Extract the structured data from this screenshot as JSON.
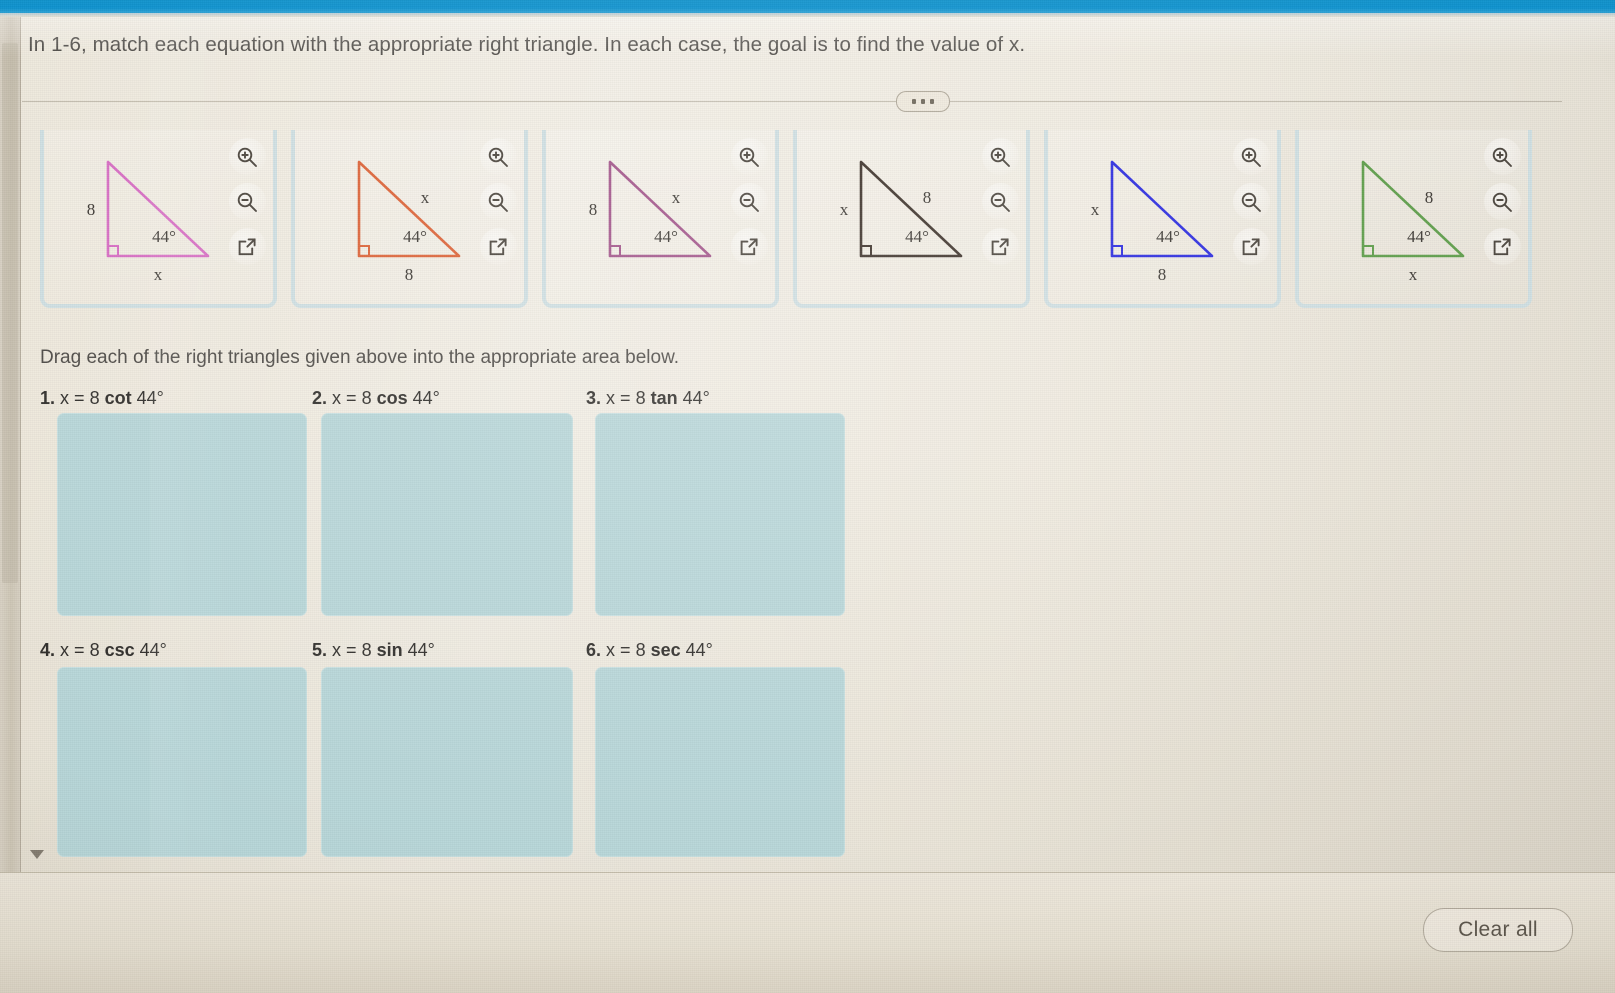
{
  "topbar": {
    "color": "#0f93cf"
  },
  "prompt": {
    "text": "In 1-6, match each equation with the appropriate right triangle. In each case, the goal is to find the value of x."
  },
  "divider": {
    "expander_label": "•••"
  },
  "cards": {
    "icons": {
      "zoom_in": "zoom-in-icon",
      "zoom_out": "zoom-out-icon",
      "open_new": "open-in-new-window-icon"
    },
    "items": [
      {
        "id": 1,
        "color": "#d86ec4",
        "vertical_label": "8",
        "horizontal_label": "x",
        "hypotenuse_label": "",
        "angle_label": "44°"
      },
      {
        "id": 2,
        "color": "#dd6236",
        "vertical_label": "",
        "horizontal_label": "8",
        "hypotenuse_label": "x",
        "angle_label": "44°"
      },
      {
        "id": 3,
        "color": "#a3558b",
        "vertical_label": "8",
        "horizontal_label": "",
        "hypotenuse_label": "x",
        "angle_label": "44°"
      },
      {
        "id": 4,
        "color": "#3c3129",
        "vertical_label": "x",
        "horizontal_label": "",
        "hypotenuse_label": "8",
        "angle_label": "44°"
      },
      {
        "id": 5,
        "color": "#2a2ae0",
        "vertical_label": "x",
        "horizontal_label": "8",
        "hypotenuse_label": "",
        "angle_label": "44°"
      },
      {
        "id": 6,
        "color": "#5e9e4a",
        "vertical_label": "",
        "horizontal_label": "x",
        "hypotenuse_label": "8",
        "angle_label": "44°"
      }
    ]
  },
  "drag_note": {
    "text": "Drag each of the right triangles given above into the appropriate area below."
  },
  "questions": [
    {
      "number": "1.",
      "lhs": "x =",
      "coef": "8",
      "fn": "cot",
      "angle": "44°"
    },
    {
      "number": "2.",
      "lhs": "x =",
      "coef": "8",
      "fn": "cos",
      "angle": "44°"
    },
    {
      "number": "3.",
      "lhs": "x =",
      "coef": "8",
      "fn": "tan",
      "angle": "44°"
    },
    {
      "number": "4.",
      "lhs": "x =",
      "coef": "8",
      "fn": "csc",
      "angle": "44°"
    },
    {
      "number": "5.",
      "lhs": "x =",
      "coef": "8",
      "fn": "sin",
      "angle": "44°"
    },
    {
      "number": "6.",
      "lhs": "x =",
      "coef": "8",
      "fn": "sec",
      "angle": "44°"
    }
  ],
  "dropzones": {
    "fill_color": "#b7d6d8",
    "count": 6,
    "empty": true
  },
  "footer": {
    "clear_all_label": "Clear all"
  }
}
